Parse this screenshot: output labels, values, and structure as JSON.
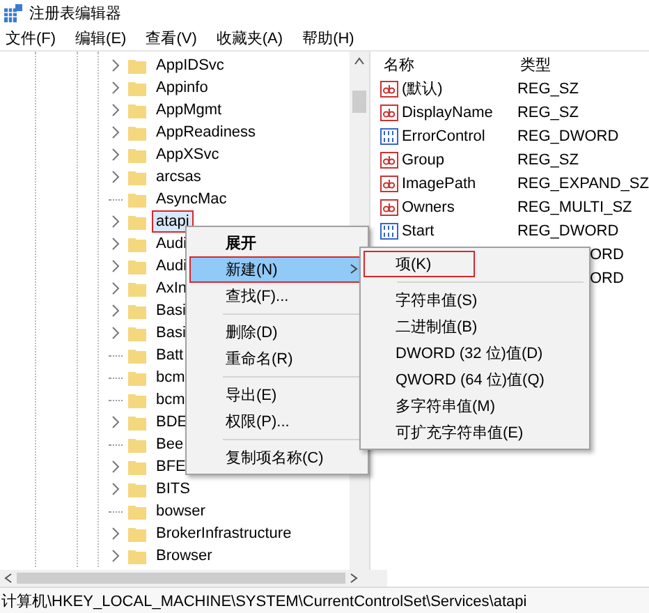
{
  "window": {
    "title": "注册表编辑器"
  },
  "menu_bar": [
    "文件(F)",
    "编辑(E)",
    "查看(V)",
    "收藏夹(A)",
    "帮助(H)"
  ],
  "tree": {
    "items": [
      {
        "label": "AppIDSvc",
        "has_children": true,
        "selected": false,
        "highlighted": false
      },
      {
        "label": "Appinfo",
        "has_children": true,
        "selected": false,
        "highlighted": false
      },
      {
        "label": "AppMgmt",
        "has_children": true,
        "selected": false,
        "highlighted": false
      },
      {
        "label": "AppReadiness",
        "has_children": true,
        "selected": false,
        "highlighted": false
      },
      {
        "label": "AppXSvc",
        "has_children": true,
        "selected": false,
        "highlighted": false
      },
      {
        "label": "arcsas",
        "has_children": true,
        "selected": false,
        "highlighted": false
      },
      {
        "label": "AsyncMac",
        "has_children": false,
        "selected": false,
        "highlighted": false
      },
      {
        "label": "atapi",
        "has_children": true,
        "selected": true,
        "highlighted": true
      },
      {
        "label": "Audi",
        "has_children": true,
        "selected": false,
        "highlighted": false
      },
      {
        "label": "Audi",
        "has_children": true,
        "selected": false,
        "highlighted": false
      },
      {
        "label": "AxIn",
        "has_children": true,
        "selected": false,
        "highlighted": false
      },
      {
        "label": "Basi",
        "has_children": true,
        "selected": false,
        "highlighted": false
      },
      {
        "label": "Basi",
        "has_children": true,
        "selected": false,
        "highlighted": false
      },
      {
        "label": "Batt",
        "has_children": false,
        "selected": false,
        "highlighted": false
      },
      {
        "label": "bcm",
        "has_children": false,
        "selected": false,
        "highlighted": false
      },
      {
        "label": "bcm",
        "has_children": false,
        "selected": false,
        "highlighted": false
      },
      {
        "label": "BDE",
        "has_children": true,
        "selected": false,
        "highlighted": false
      },
      {
        "label": "Bee",
        "has_children": false,
        "selected": false,
        "highlighted": false
      },
      {
        "label": "BFE",
        "has_children": true,
        "selected": false,
        "highlighted": false
      },
      {
        "label": "BITS",
        "has_children": true,
        "selected": false,
        "highlighted": false
      },
      {
        "label": "bowser",
        "has_children": false,
        "selected": false,
        "highlighted": false
      },
      {
        "label": "BrokerInfrastructure",
        "has_children": true,
        "selected": false,
        "highlighted": false
      },
      {
        "label": "Browser",
        "has_children": true,
        "selected": false,
        "highlighted": false
      }
    ]
  },
  "values": {
    "columns": [
      "名称",
      "类型"
    ],
    "rows": [
      {
        "kind": "string",
        "name": "(默认)",
        "type": "REG_SZ"
      },
      {
        "kind": "string",
        "name": "DisplayName",
        "type": "REG_SZ"
      },
      {
        "kind": "binary",
        "name": "ErrorControl",
        "type": "REG_DWORD"
      },
      {
        "kind": "string",
        "name": "Group",
        "type": "REG_SZ"
      },
      {
        "kind": "string",
        "name": "ImagePath",
        "type": "REG_EXPAND_SZ"
      },
      {
        "kind": "string",
        "name": "Owners",
        "type": "REG_MULTI_SZ"
      },
      {
        "kind": "binary",
        "name": "Start",
        "type": "REG_DWORD"
      },
      {
        "kind": "covered",
        "type": "ORD"
      },
      {
        "kind": "covered",
        "type": "ORD"
      }
    ]
  },
  "context_menu": {
    "items": [
      {
        "kind": "item",
        "label": "展开",
        "bold": true,
        "selected": false,
        "highlighted": false,
        "submenu": false
      },
      {
        "kind": "item",
        "label": "新建(N)",
        "bold": false,
        "selected": true,
        "highlighted": true,
        "submenu": true
      },
      {
        "kind": "item",
        "label": "查找(F)...",
        "bold": false,
        "selected": false,
        "highlighted": false,
        "submenu": false
      },
      {
        "kind": "separator"
      },
      {
        "kind": "item",
        "label": "删除(D)",
        "bold": false,
        "selected": false,
        "highlighted": false,
        "submenu": false
      },
      {
        "kind": "item",
        "label": "重命名(R)",
        "bold": false,
        "selected": false,
        "highlighted": false,
        "submenu": false
      },
      {
        "kind": "separator"
      },
      {
        "kind": "item",
        "label": "导出(E)",
        "bold": false,
        "selected": false,
        "highlighted": false,
        "submenu": false
      },
      {
        "kind": "item",
        "label": "权限(P)...",
        "bold": false,
        "selected": false,
        "highlighted": false,
        "submenu": false
      },
      {
        "kind": "separator"
      },
      {
        "kind": "item",
        "label": "复制项名称(C)",
        "bold": false,
        "selected": false,
        "highlighted": false,
        "submenu": false
      }
    ]
  },
  "submenu": {
    "items": [
      {
        "kind": "item",
        "label": "项(K)",
        "highlighted": true
      },
      {
        "kind": "separator"
      },
      {
        "kind": "item",
        "label": "字符串值(S)",
        "highlighted": false
      },
      {
        "kind": "item",
        "label": "二进制值(B)",
        "highlighted": false
      },
      {
        "kind": "item",
        "label": "DWORD (32 位)值(D)",
        "highlighted": false
      },
      {
        "kind": "item",
        "label": "QWORD (64 位)值(Q)",
        "highlighted": false
      },
      {
        "kind": "item",
        "label": "多字符串值(M)",
        "highlighted": false
      },
      {
        "kind": "item",
        "label": "可扩充字符串值(E)",
        "highlighted": false
      }
    ]
  },
  "status_bar": "计算机\\HKEY_LOCAL_MACHINE\\SYSTEM\\CurrentControlSet\\Services\\atapi"
}
